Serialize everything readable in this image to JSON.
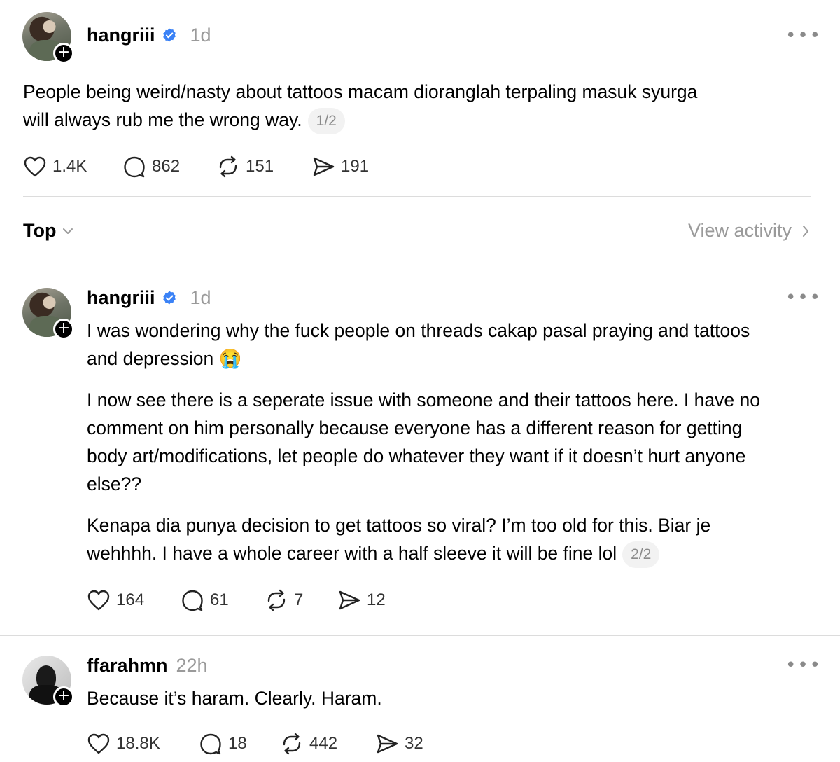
{
  "posts": [
    {
      "username": "hangriii",
      "verified": true,
      "time": "1d",
      "paragraphs": [
        "People being weird/nasty about tattoos macam dioranglah terpaling masuk syurga will always rub me the wrong way."
      ],
      "counter": "1/2",
      "likes": "1.4K",
      "comments": "862",
      "reposts": "151",
      "shares": "191"
    },
    {
      "username": "hangriii",
      "verified": true,
      "time": "1d",
      "paragraphs": [
        "I was wondering why the fuck people on threads cakap pasal praying and tattoos and depression 😭",
        "I now see there is a seperate issue with someone and their tattoos here. I have no comment on him personally because everyone has a different reason for getting body art/modifications, let people do whatever they want if it doesn’t hurt anyone else??",
        "Kenapa dia punya decision to get tattoos so viral? I’m too old for this. Biar je wehhhh. I have a whole career with a half sleeve it will be fine lol"
      ],
      "counter": "2/2",
      "likes": "164",
      "comments": "61",
      "reposts": "7",
      "shares": "12"
    },
    {
      "username": "ffarahmn",
      "verified": false,
      "time": "22h",
      "paragraphs": [
        "Because it’s haram. Clearly. Haram."
      ],
      "likes": "18.8K",
      "comments": "18",
      "reposts": "442",
      "shares": "32"
    }
  ],
  "sort": {
    "label": "Top",
    "view_activity": "View activity"
  },
  "icons": {
    "more": "more-icon",
    "like": "heart-icon",
    "comment": "comment-icon",
    "repost": "repost-icon",
    "share": "share-icon",
    "verified": "verified-badge-icon",
    "follow": "plus-icon"
  },
  "colors": {
    "verified": "#3b82f6",
    "muted": "#9a9a9a",
    "divider": "#dcdcdc"
  }
}
